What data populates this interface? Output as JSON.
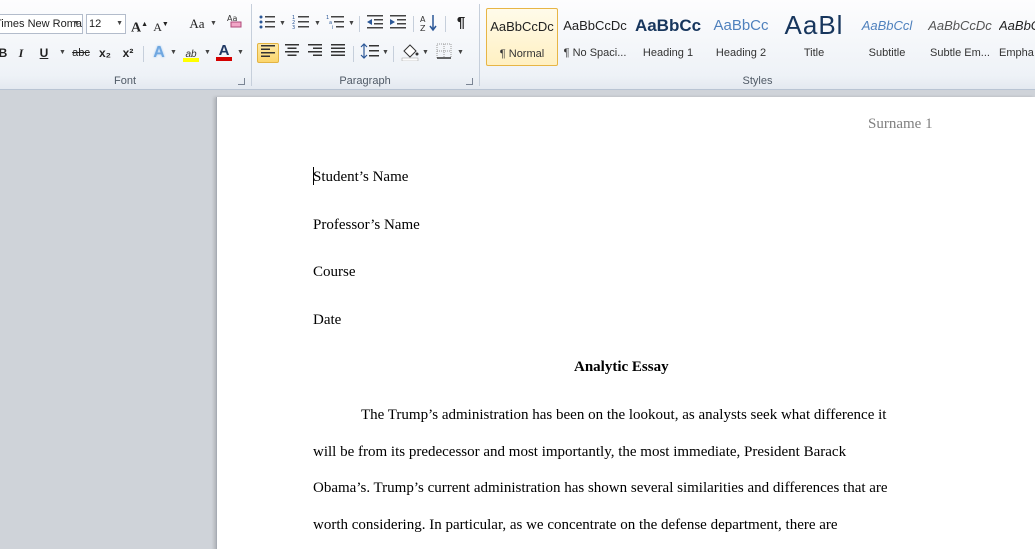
{
  "ribbon": {
    "font": {
      "label": "Font",
      "font_name": "Times New Roman",
      "font_size": "12",
      "buttons": {
        "grow": "A",
        "shrink": "A",
        "change_case": "Aa",
        "bold": "B",
        "italic": "I",
        "underline": "U",
        "strike": "abc",
        "subscript": "x₂",
        "superscript": "x²",
        "text_effects": "A",
        "highlight": "ab",
        "font_color": "A"
      }
    },
    "paragraph": {
      "label": "Paragraph",
      "pilcrow": "¶"
    },
    "styles": {
      "label": "Styles",
      "items": [
        {
          "sample": "AaBbCcDc",
          "name": "¶ Normal"
        },
        {
          "sample": "AaBbCcDc",
          "name": "¶ No Spaci..."
        },
        {
          "sample": "AaBbCc",
          "name": "Heading 1"
        },
        {
          "sample": "AaBbCc",
          "name": "Heading 2"
        },
        {
          "sample": "AaBl",
          "name": "Title"
        },
        {
          "sample": "AaBbCcl",
          "name": "Subtitle"
        },
        {
          "sample": "AaBbCcDc",
          "name": "Subtle Em..."
        },
        {
          "sample": "AaBbCcDc",
          "name": "Empha"
        }
      ]
    }
  },
  "document": {
    "header": "Surname  1",
    "lines": [
      "Student’s Name",
      "Professor’s Name",
      "Course",
      "Date"
    ],
    "title": "Analytic Essay",
    "body": [
      "The Trump’s  administration has been on the lookout, as analysts seek what difference it",
      "will be from its predecessor and most importantly, the most immediate, President Barack",
      "Obama’s. Trump’s  current administration has shown several similarities  and differences that are",
      "worth considering.  In particular,  as we concentrate on the defense department, there are"
    ]
  },
  "colors": {
    "highlight": "#ffff00",
    "font_color": "#d40000",
    "heading1": "#17365d",
    "heading2": "#4f81bd",
    "selected_style": "#fff0c2"
  }
}
